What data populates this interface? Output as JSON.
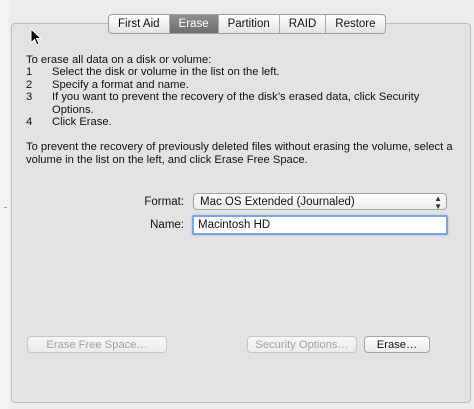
{
  "tabs": [
    {
      "label": "First Aid",
      "active": false
    },
    {
      "label": "Erase",
      "active": true
    },
    {
      "label": "Partition",
      "active": false
    },
    {
      "label": "RAID",
      "active": false
    },
    {
      "label": "Restore",
      "active": false
    }
  ],
  "instructions": {
    "intro": "To erase all data on a disk or volume:",
    "steps": [
      {
        "num": "1",
        "text": "Select the disk or volume in the list on the left."
      },
      {
        "num": "2",
        "text": "Specify a format and name."
      },
      {
        "num": "3",
        "text": "If you want to prevent the recovery of the disk’s erased data, click Security Options."
      },
      {
        "num": "4",
        "text": "Click Erase."
      }
    ],
    "free_space": "To prevent the recovery of previously deleted files without erasing the volume, select a volume in the list on the left, and click Erase Free Space."
  },
  "form": {
    "format_label": "Format:",
    "format_value": "Mac OS Extended (Journaled)",
    "name_label": "Name:",
    "name_value": "Macintosh HD"
  },
  "buttons": {
    "erase_free_space": "Erase Free Space…",
    "security_options": "Security Options…",
    "erase": "Erase…"
  },
  "colors": {
    "active_tab": "#7d7d7d",
    "focus_ring": "#7aa7e0",
    "disabled_text": "#a2a2a2"
  },
  "icons": {
    "pointer": "mouse-pointer-icon",
    "select_arrows": "updown-arrows-icon"
  }
}
